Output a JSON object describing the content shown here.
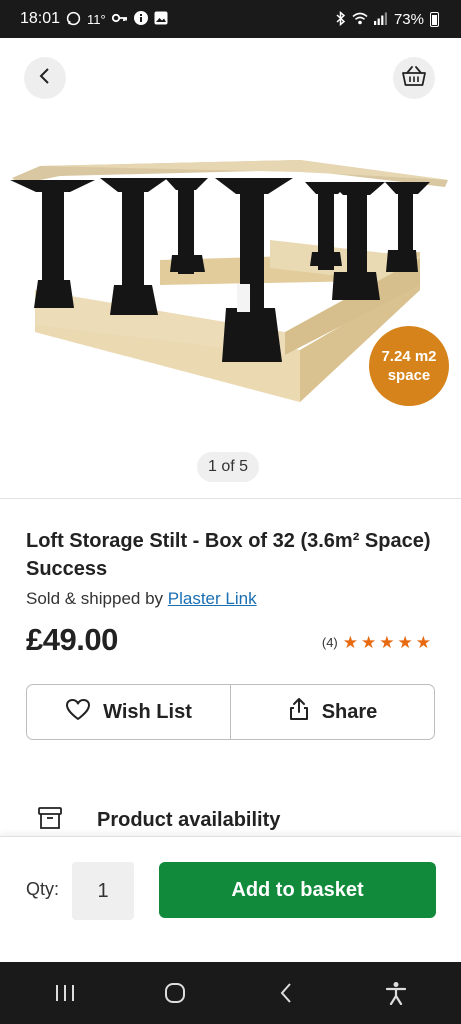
{
  "status_bar": {
    "time": "18:01",
    "temperature": "11°",
    "battery": "73%"
  },
  "product": {
    "image_badge": [
      "7.24 m2",
      "space"
    ],
    "image_pager": "1 of 5",
    "title": "Loft Storage Stilt - Box of 32 (3.6m² Space) Success",
    "seller_prefix": "Sold & shipped by ",
    "seller_name": "Plaster Link",
    "price": "£49.00",
    "rating_count": "(4)",
    "rating_stars": 5
  },
  "actions": {
    "wishlist_label": "Wish List",
    "share_label": "Share"
  },
  "availability": {
    "label": "Product availability"
  },
  "purchase": {
    "qty_label": "Qty:",
    "qty_value": "1",
    "add_button_label": "Add to basket"
  },
  "colors": {
    "primary_green": "#118a3b",
    "star_orange": "#e86a10",
    "badge_orange": "#d5831a",
    "link_blue": "#1a6fb3"
  },
  "icons": {
    "back": "chevron-left-icon",
    "basket": "basket-icon",
    "wishlist": "heart-icon",
    "share": "share-icon",
    "availability": "archive-box-icon"
  }
}
